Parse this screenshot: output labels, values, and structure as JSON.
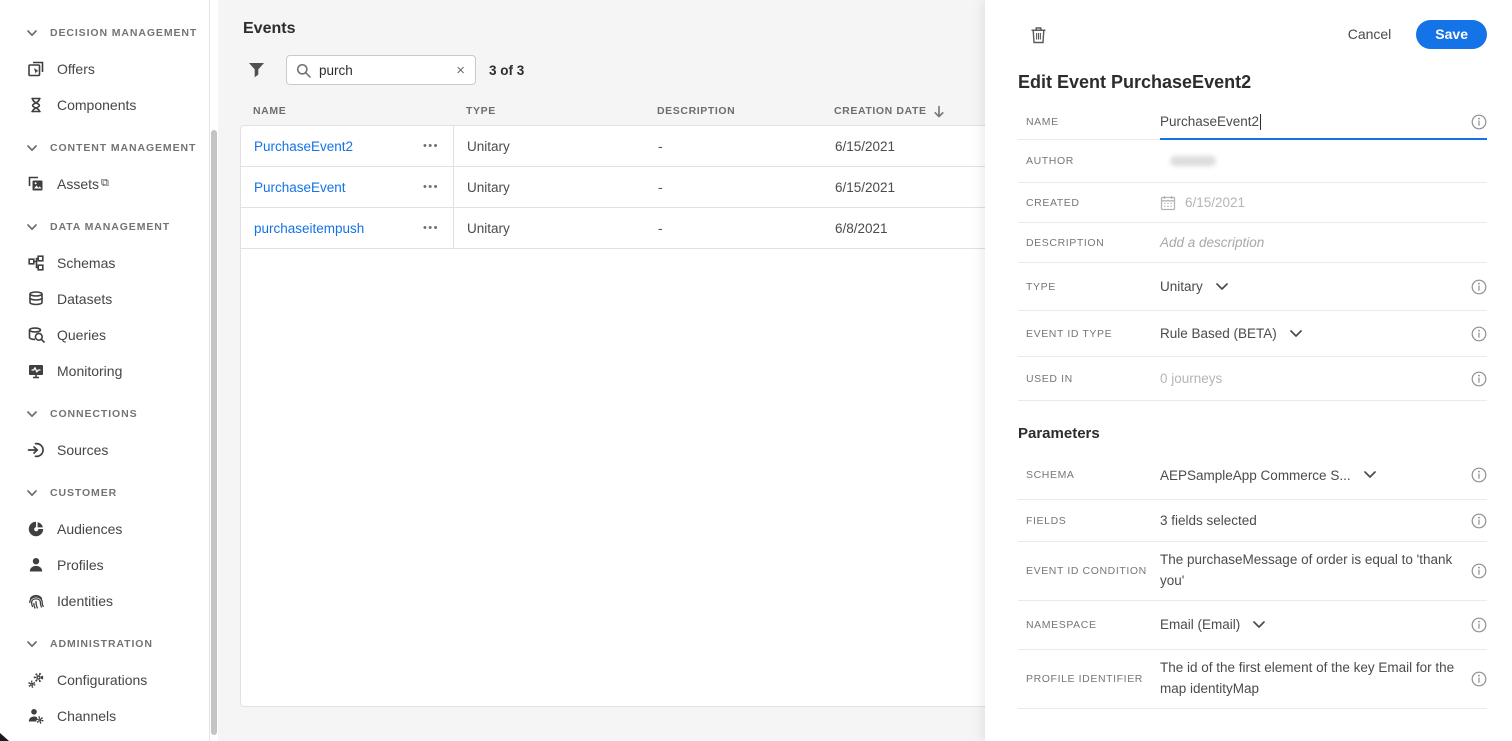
{
  "colors": {
    "accent": "#1473e6",
    "link": "#1473e6"
  },
  "icons": {
    "more": "•••",
    "clear": "×",
    "assets_external": "⧉"
  },
  "sidebar": {
    "items": [
      {
        "label": "DECISION MANAGEMENT"
      },
      {
        "label": "Offers"
      },
      {
        "label": "Components"
      },
      {
        "label": "CONTENT MANAGEMENT"
      },
      {
        "label": "Assets"
      },
      {
        "label": "DATA MANAGEMENT"
      },
      {
        "label": "Schemas"
      },
      {
        "label": "Datasets"
      },
      {
        "label": "Queries"
      },
      {
        "label": "Monitoring"
      },
      {
        "label": "CONNECTIONS"
      },
      {
        "label": "Sources"
      },
      {
        "label": "CUSTOMER"
      },
      {
        "label": "Audiences"
      },
      {
        "label": "Profiles"
      },
      {
        "label": "Identities"
      },
      {
        "label": "ADMINISTRATION"
      },
      {
        "label": "Configurations"
      },
      {
        "label": "Channels"
      }
    ]
  },
  "events": {
    "title": "Events",
    "search": {
      "value": "purch",
      "results_count": "3 of 3"
    },
    "table": {
      "headers": {
        "name": "NAME",
        "type": "TYPE",
        "description": "DESCRIPTION",
        "creation_date": "CREATION DATE"
      },
      "rows": [
        {
          "name": "PurchaseEvent2",
          "type": "Unitary",
          "description": "-",
          "creation_date": "6/15/2021"
        },
        {
          "name": "PurchaseEvent",
          "type": "Unitary",
          "description": "-",
          "creation_date": "6/15/2021"
        },
        {
          "name": "purchaseitempush",
          "type": "Unitary",
          "description": "-",
          "creation_date": "6/8/2021"
        }
      ]
    }
  },
  "editor": {
    "cancel_label": "Cancel",
    "save_label": "Save",
    "title": "Edit Event PurchaseEvent2",
    "name": {
      "label": "NAME",
      "value": "PurchaseEvent2"
    },
    "author": {
      "label": "AUTHOR"
    },
    "created": {
      "label": "CREATED",
      "value": "6/15/2021"
    },
    "description": {
      "label": "DESCRIPTION",
      "placeholder": "Add a description"
    },
    "type": {
      "label": "TYPE",
      "value": "Unitary"
    },
    "event_id_type": {
      "label": "EVENT ID TYPE",
      "value": "Rule Based (BETA)"
    },
    "used_in": {
      "label": "USED IN",
      "value": "0 journeys"
    },
    "parameters_title": "Parameters",
    "schema": {
      "label": "SCHEMA",
      "value": "AEPSampleApp Commerce S..."
    },
    "fields": {
      "label": "FIELDS",
      "value": "3 fields selected"
    },
    "event_id_condition": {
      "label": "EVENT ID CONDITION",
      "value": "The purchaseMessage of order is equal to 'thank you'"
    },
    "namespace": {
      "label": "NAMESPACE",
      "value": "Email (Email)"
    },
    "profile_identifier": {
      "label": "PROFILE IDENTIFIER",
      "value": "The id of the first element of the key Email for the map identityMap"
    }
  }
}
